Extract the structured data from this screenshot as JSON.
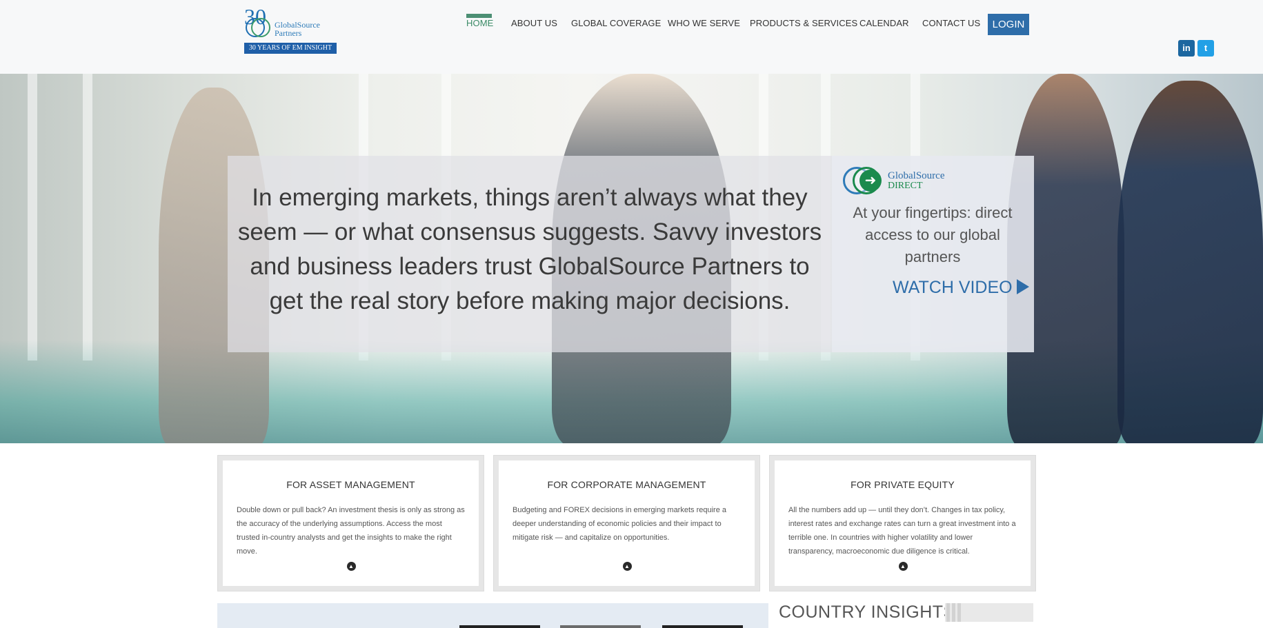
{
  "brand": {
    "logo_number": "30",
    "logo_name_line1": "GlobalSource",
    "logo_name_line2": "Partners",
    "logo_tagline": "30 YEARS OF EM INSIGHT",
    "accent_color": "#2e6da9",
    "green_color": "#3a8a66"
  },
  "nav": {
    "items": [
      {
        "label": "HOME",
        "active": true
      },
      {
        "label": "ABOUT US"
      },
      {
        "label": "GLOBAL COVERAGE"
      },
      {
        "label": "WHO WE SERVE"
      },
      {
        "label": "PRODUCTS & SERVICES"
      },
      {
        "label": "CALENDAR"
      },
      {
        "label": "CONTACT US"
      }
    ],
    "login_label": "LOGIN"
  },
  "social": {
    "linkedin_icon": "linkedin-icon",
    "linkedin_label": "in",
    "twitter_icon": "twitter-icon",
    "twitter_label": "t"
  },
  "hero": {
    "quote": "In emerging markets, things aren’t always what they seem — or what consensus suggests. Savvy investors and business leaders trust GlobalSource Partners to get the real story before making major decisions.",
    "direct_logo_line1": "GlobalSource",
    "direct_logo_line2": "DIRECT",
    "direct_text": "At your fingertips: direct access to our global partners",
    "watch_video": "WATCH VIDEO"
  },
  "cards": [
    {
      "title": "FOR ASSET MANAGEMENT",
      "body": "Double down or pull back? An investment thesis is only as strong as the accuracy of the underlying assumptions. Access the most trusted in-country analysts and get the insights to make the right move."
    },
    {
      "title": "FOR CORPORATE MANAGEMENT",
      "body": "Budgeting and FOREX decisions in emerging markets require a deeper understanding of economic policies and their impact to mitigate risk — and capitalize on opportunities."
    },
    {
      "title": "FOR PRIVATE EQUITY",
      "body": "All the numbers add up — until they don’t. Changes in tax policy, interest rates and exchange rates can turn a great investment into a terrible one. In countries with higher volatility and lower transparency, macroeconomic due diligence is critical."
    }
  ],
  "country_insights": {
    "title": "COUNTRY INSIGHTS"
  }
}
